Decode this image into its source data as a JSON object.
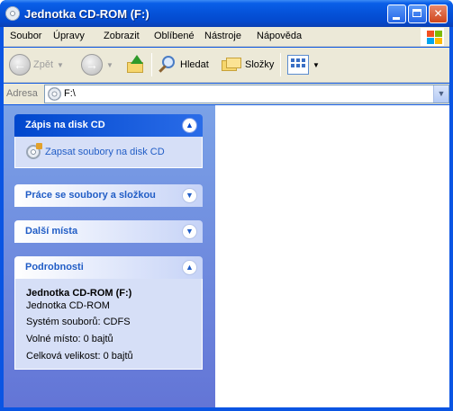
{
  "window": {
    "title": "Jednotka CD-ROM (F:)",
    "buttons": {
      "minimize": "minimize",
      "maximize": "maximize",
      "close": "✕"
    }
  },
  "menu": {
    "items": [
      "Soubor",
      "Úpravy",
      "Zobrazit",
      "Oblíbené",
      "Nástroje",
      "Nápověda"
    ]
  },
  "toolbar": {
    "back_label": "Zpět",
    "search_label": "Hledat",
    "folders_label": "Složky"
  },
  "address": {
    "label": "Adresa",
    "value": "F:\\"
  },
  "taskpane": {
    "cd_tasks": {
      "title": "Zápis na disk CD",
      "link": "Zapsat soubory na disk CD"
    },
    "file_tasks": {
      "title": "Práce se soubory a složkou"
    },
    "other_places": {
      "title": "Další místa"
    },
    "details": {
      "title": "Podrobnosti",
      "name": "Jednotka CD-ROM (F:)",
      "type": "Jednotka CD-ROM",
      "filesystem": "Systém souborů: CDFS",
      "free_space": "Volné místo: 0 bajtů",
      "total_size": "Celková velikost: 0 bajtů"
    }
  },
  "colors": {
    "titlebar": "#0553da",
    "taskpane_top": "#7ba2e7",
    "taskpane_bottom": "#6375d6",
    "link": "#215dc6"
  }
}
